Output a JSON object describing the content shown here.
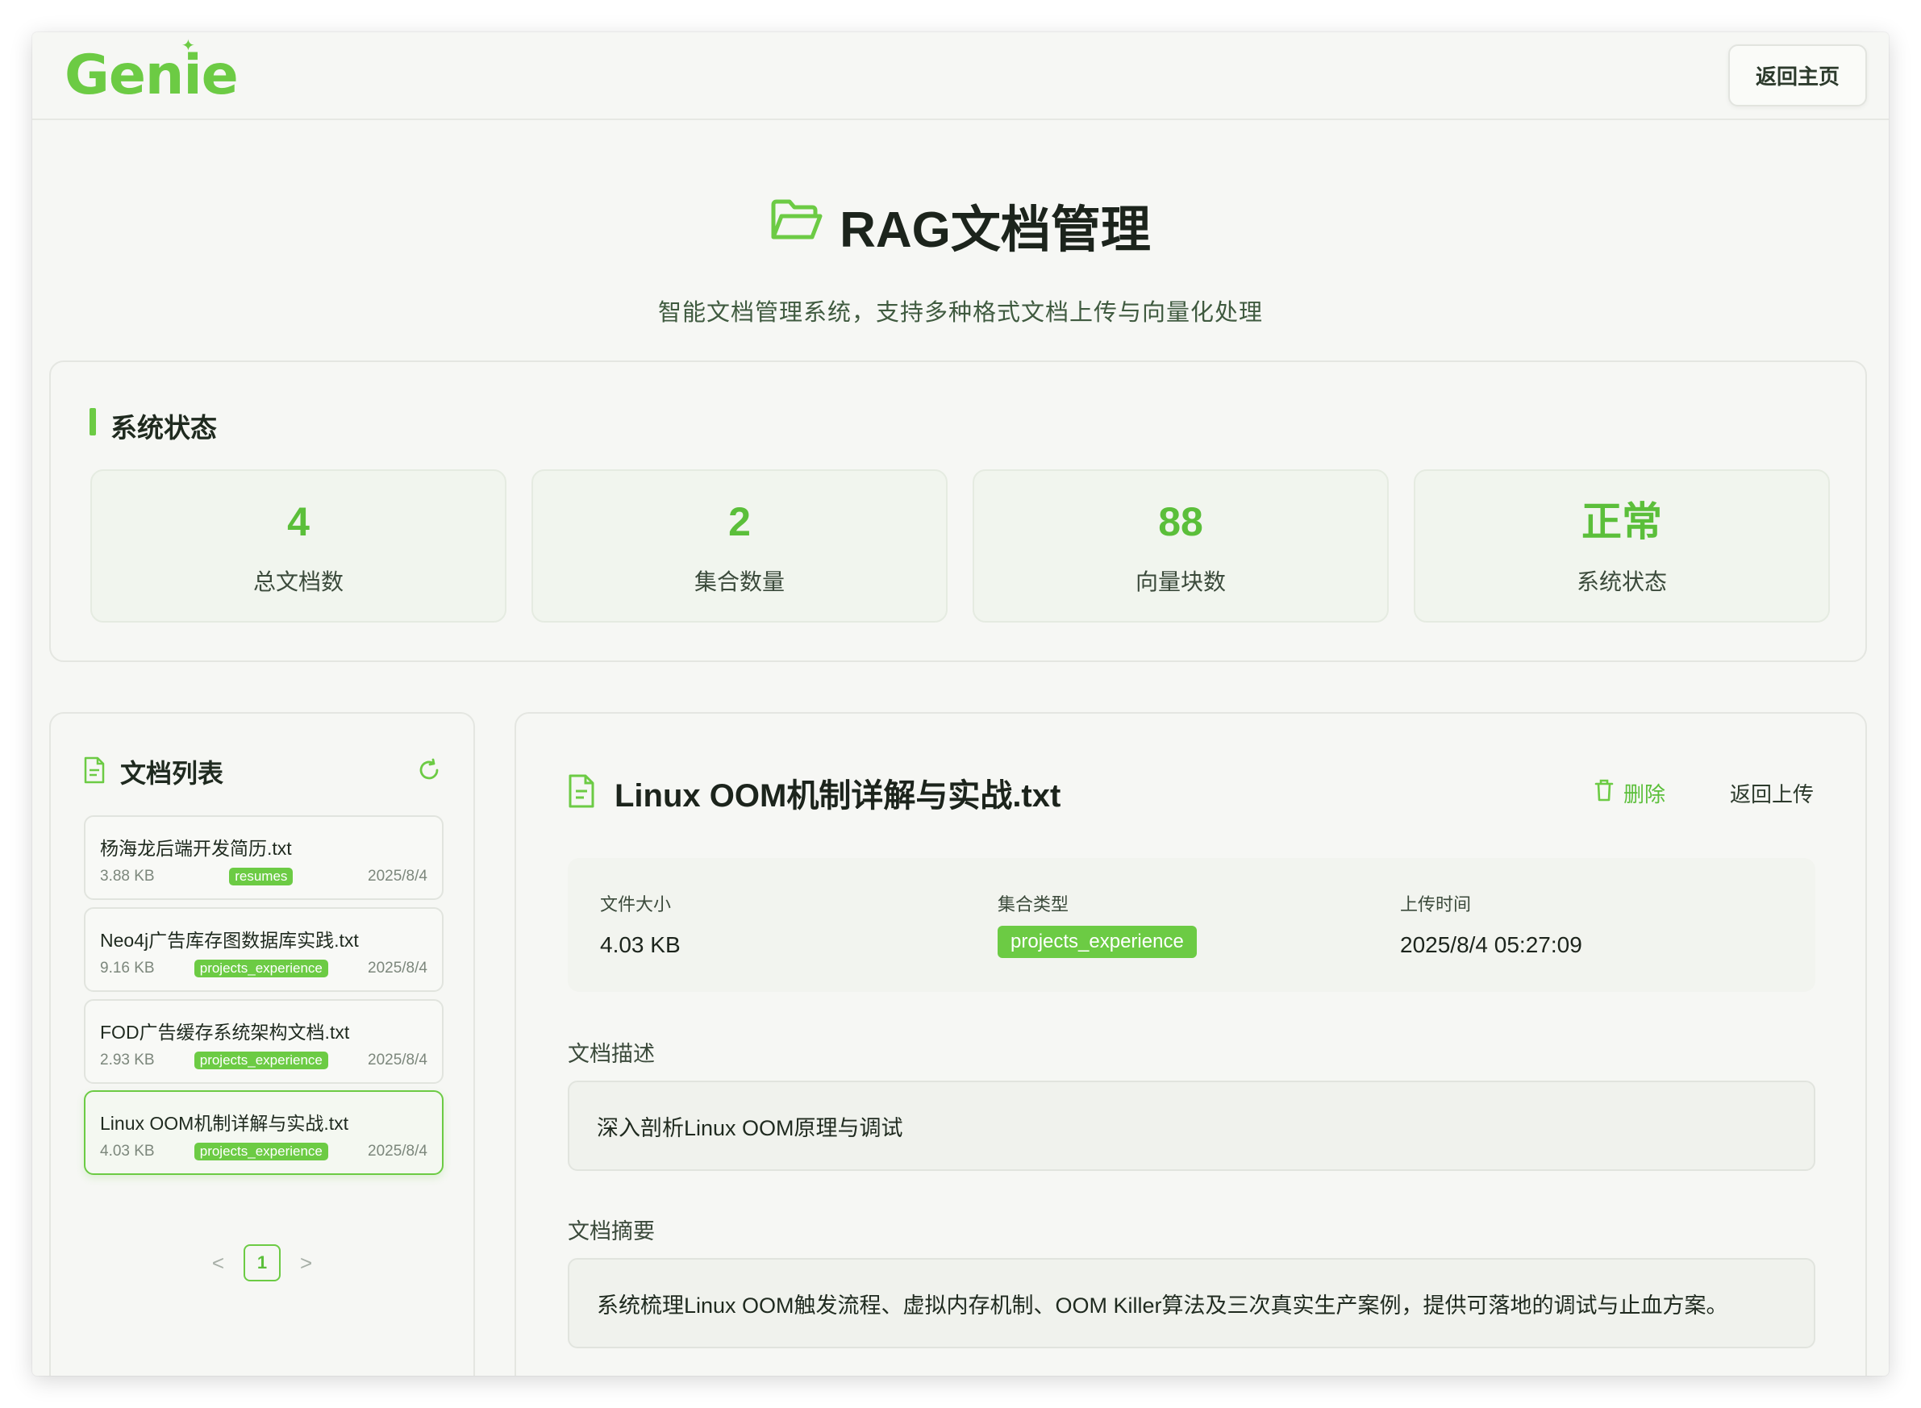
{
  "header": {
    "logo": "Genie",
    "home_button": "返回主页"
  },
  "hero": {
    "title": "RAG文档管理",
    "subtitle": "智能文档管理系统，支持多种格式文档上传与向量化处理"
  },
  "status": {
    "title": "系统状态",
    "stats": [
      {
        "value": "4",
        "label": "总文档数"
      },
      {
        "value": "2",
        "label": "集合数量"
      },
      {
        "value": "88",
        "label": "向量块数"
      },
      {
        "value": "正常",
        "label": "系统状态"
      }
    ]
  },
  "doc_list": {
    "title": "文档列表",
    "items": [
      {
        "name": "杨海龙后端开发简历.txt",
        "size": "3.88 KB",
        "tag": "resumes",
        "date": "2025/8/4"
      },
      {
        "name": "Neo4j广告库存图数据库实践.txt",
        "size": "9.16 KB",
        "tag": "projects_experience",
        "date": "2025/8/4"
      },
      {
        "name": "FOD广告缓存系统架构文档.txt",
        "size": "2.93 KB",
        "tag": "projects_experience",
        "date": "2025/8/4"
      },
      {
        "name": "Linux OOM机制详解与实战.txt",
        "size": "4.03 KB",
        "tag": "projects_experience",
        "date": "2025/8/4"
      }
    ],
    "pagination": {
      "prev": "<",
      "page": "1",
      "next": ">"
    }
  },
  "detail": {
    "title": "Linux OOM机制详解与实战.txt",
    "delete_label": "删除",
    "back_label": "返回上传",
    "file_size_label": "文件大小",
    "file_size": "4.03 KB",
    "collection_label": "集合类型",
    "collection": "projects_experience",
    "upload_time_label": "上传时间",
    "upload_time": "2025/8/4 05:27:09",
    "description_label": "文档描述",
    "description": "深入剖析Linux OOM原理与调试",
    "summary_label": "文档摘要",
    "summary": "系统梳理Linux OOM触发流程、虚拟内存机制、OOM Killer算法及三次真实生产案例，提供可落地的调试与止血方案。"
  },
  "colors": {
    "accent": "#6ccb44",
    "background": "#f6f7f4"
  }
}
